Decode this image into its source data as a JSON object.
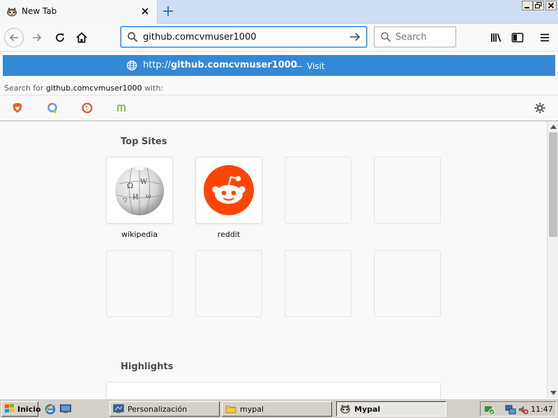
{
  "browser": {
    "tab": {
      "title": "New Tab",
      "favicon": "mypal-raccoon-icon"
    },
    "window_controls": [
      "minimize",
      "maximize",
      "close"
    ]
  },
  "navbar": {
    "url_value": "github.comcvmuser1000",
    "search_placeholder": "Search",
    "icons": [
      "back-icon",
      "forward-icon",
      "reload-icon",
      "home-icon",
      "library-icon",
      "sidebar-icon",
      "menu-icon"
    ]
  },
  "urlbar_popup": {
    "suggestion": {
      "url_prefix": "http://",
      "url_domain": "github.comcvmuser1000",
      "separator": "—",
      "action": "Visit"
    },
    "search_with": {
      "prefix": "Search for ",
      "query": "github.comcvmuser1000",
      "suffix": " with:"
    },
    "engines": [
      "brave-search-icon",
      "qwant-icon",
      "duckduckgo-icon",
      "mojeek-icon"
    ],
    "settings_icon": "gear-icon"
  },
  "newtab": {
    "top_sites_title": "Top Sites",
    "top_sites": [
      {
        "label": "wikipedia",
        "icon": "wikipedia-globe-icon"
      },
      {
        "label": "reddit",
        "icon": "reddit-alien-icon"
      },
      {
        "label": ""
      },
      {
        "label": ""
      },
      {
        "label": ""
      },
      {
        "label": ""
      },
      {
        "label": ""
      },
      {
        "label": ""
      }
    ],
    "highlights_title": "Highlights"
  },
  "taskbar": {
    "start_label": "Inicio",
    "items": [
      {
        "label": "Personalización",
        "icon": "display-properties-icon",
        "active": false
      },
      {
        "label": "mypal",
        "icon": "folder-icon",
        "active": false
      },
      {
        "label": "Mypal",
        "icon": "mypal-raccoon-icon",
        "active": true
      }
    ],
    "clock": "11:47"
  },
  "colors": {
    "accent": "#0a84ff",
    "suggestion_bg": "#3389d5",
    "reddit": "#ff4500",
    "tabstrip": "#cfdff3"
  }
}
